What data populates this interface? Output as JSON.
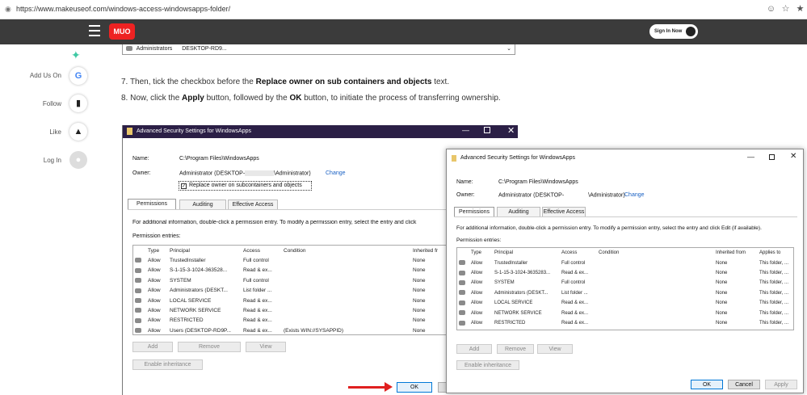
{
  "browser": {
    "url": "https://www.makeuseof.com/windows-access-windowsapps-folder/"
  },
  "site": {
    "logo": "MUO",
    "sign_in": "Sign In Now"
  },
  "social": [
    {
      "label": "Add Us On",
      "icon": "google-icon"
    },
    {
      "label": "Follow",
      "icon": "bookmark-icon"
    },
    {
      "label": "Like",
      "icon": "thumbs-up-icon"
    },
    {
      "label": "Log In",
      "icon": "user-icon"
    }
  ],
  "dropdown": {
    "principal": "Administrators",
    "location": "DESKTOP-RD9..."
  },
  "article": {
    "step7_pre": "7. Then, tick the checkbox before the ",
    "step7_bold": "Replace owner on sub containers and objects",
    "step7_post": " text.",
    "step8_pre": "8. Now, click the ",
    "step8_apply": "Apply",
    "step8_mid": " button, followed by the ",
    "step8_ok": "OK",
    "step8_post": " button, to initiate the process of transferring ownership."
  },
  "dialog1": {
    "title": "Advanced Security Settings for WindowsApps",
    "name_label": "Name:",
    "name_value": "C:\\Program Files\\WindowsApps",
    "owner_label": "Owner:",
    "owner_value_pre": "Administrator (DESKTOP-",
    "owner_value_post": "\\Administrator)",
    "change_link": "Change",
    "replace_checkbox": "Replace owner on subcontainers and objects",
    "tabs": [
      "Permissions",
      "Auditing",
      "Effective Access"
    ],
    "info": "For additional information, double-click a permission entry. To modify a permission entry, select the entry and click",
    "entries_label": "Permission entries:",
    "columns": [
      "Type",
      "Principal",
      "Access",
      "Condition",
      "Inherited fr"
    ],
    "rows": [
      [
        "Allow",
        "TrustedInstaller",
        "Full control",
        "",
        "None"
      ],
      [
        "Allow",
        "S-1-15-3-1024-363528...",
        "Read & ex...",
        "",
        "None"
      ],
      [
        "Allow",
        "SYSTEM",
        "Full control",
        "",
        "None"
      ],
      [
        "Allow",
        "Administrators (DESKT...",
        "List folder ...",
        "",
        "None"
      ],
      [
        "Allow",
        "LOCAL SERVICE",
        "Read & ex...",
        "",
        "None"
      ],
      [
        "Allow",
        "NETWORK SERVICE",
        "Read & ex...",
        "",
        "None"
      ],
      [
        "Allow",
        "RESTRICTED",
        "Read & ex...",
        "",
        "None"
      ],
      [
        "Allow",
        "Users (DESKTOP-RD9P...",
        "Read & ex...",
        "(Exists WIN://SYSAPPID)",
        "None"
      ]
    ],
    "add": "Add",
    "remove": "Remove",
    "view": "View",
    "enable_inheritance": "Enable inheritance",
    "ok": "OK"
  },
  "dialog2": {
    "title": "Advanced Security Settings for WindowsApps",
    "name_label": "Name:",
    "name_value": "C:\\Program Files\\WindowsApps",
    "owner_label": "Owner:",
    "owner_value_pre": "Administrator (DESKTOP-",
    "owner_value_post": "\\Administrator)",
    "change_link": "Change",
    "tabs": [
      "Permissions",
      "Auditing",
      "Effective Access"
    ],
    "info": "For additional information, double-click a permission entry. To modify a permission entry, select the entry and click Edit (if available).",
    "entries_label": "Permission entries:",
    "columns": [
      "Type",
      "Principal",
      "Access",
      "Condition",
      "Inherited from",
      "Applies to"
    ],
    "rows": [
      [
        "Allow",
        "TrustedInstaller",
        "Full control",
        "",
        "None",
        "This folder, ..."
      ],
      [
        "Allow",
        "S-1-15-3-1024-3635283...",
        "Read & ex...",
        "",
        "None",
        "This folder, ..."
      ],
      [
        "Allow",
        "SYSTEM",
        "Full control",
        "",
        "None",
        "This folder, ..."
      ],
      [
        "Allow",
        "Administrators (DESKT...",
        "List folder ...",
        "",
        "None",
        "This folder, ..."
      ],
      [
        "Allow",
        "LOCAL SERVICE",
        "Read & ex...",
        "",
        "None",
        "This folder, ..."
      ],
      [
        "Allow",
        "NETWORK SERVICE",
        "Read & ex...",
        "",
        "None",
        "This folder, ..."
      ],
      [
        "Allow",
        "RESTRICTED",
        "Read & ex...",
        "",
        "None",
        "This folder, ..."
      ],
      [
        "Allow",
        "Users (DESKTOP-",
        "Read & ex...",
        "(Exists WIN://SYSAPPID)",
        "None",
        "This folder, ..."
      ]
    ],
    "add": "Add",
    "remove": "Remove",
    "view": "View",
    "enable_inheritance": "Enable inheritance",
    "ok": "OK",
    "cancel": "Cancel",
    "apply": "Apply"
  },
  "colors": {
    "header_bg": "#3b3b3b",
    "logo_red": "#e22222",
    "dialog1_titlebar": "#2b1f46",
    "link_blue": "#1b62c4",
    "arrow_red": "#e02020"
  }
}
